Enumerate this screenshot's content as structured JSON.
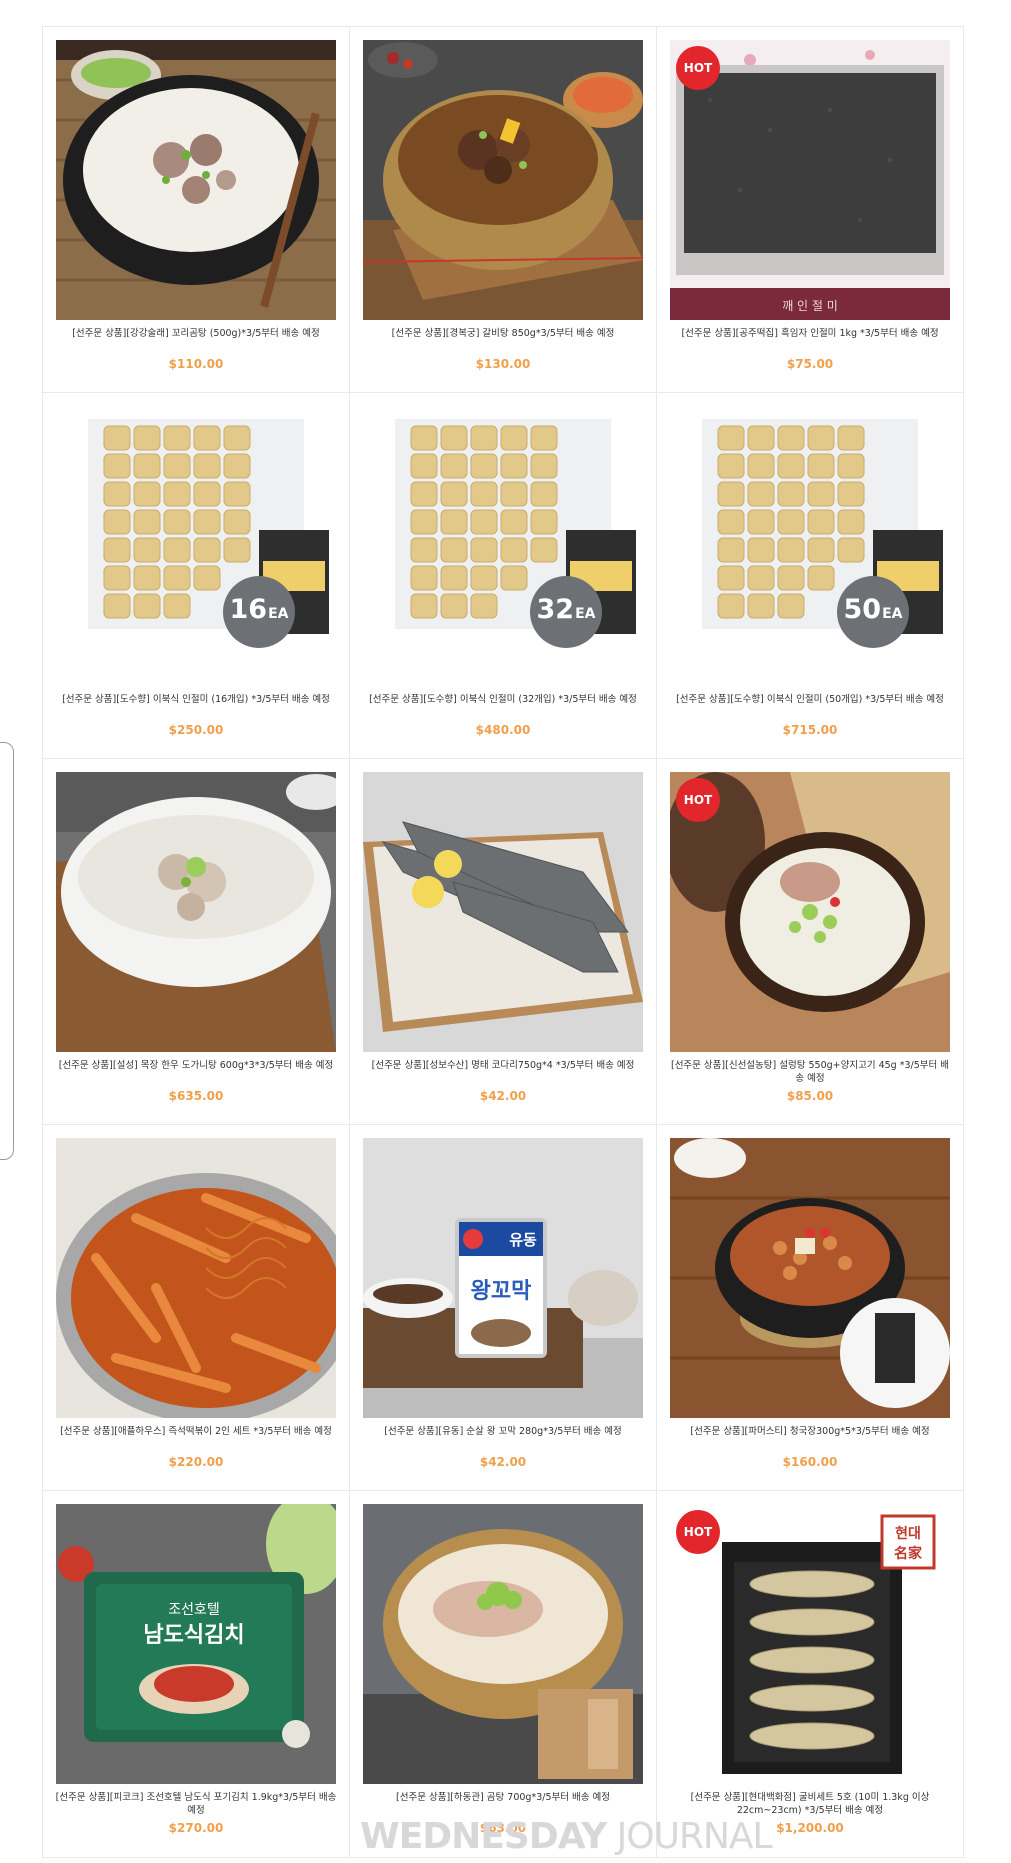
{
  "products": [
    {
      "name": "[선주문 상품][강강술래] 꼬리곰탕 (500g)*3/5부터 배송 예정",
      "price": "$110.00",
      "hot": false,
      "image": "oxtail-soup"
    },
    {
      "name": "[선주문 상품][경복궁] 갈비탕 850g*3/5부터 배송 예정",
      "price": "$130.00",
      "hot": false,
      "image": "galbi-soup"
    },
    {
      "name": "[선주문 상품][공주떡집] 흑임자 인절미 1kg *3/5부터 배송 예정",
      "price": "$75.00",
      "hot": true,
      "image": "black-sesame-injeolmi"
    },
    {
      "name": "[선주문 상품][도수향] 이북식 인절미 (16개입) *3/5부터 배송 예정",
      "price": "$250.00",
      "hot": false,
      "image": "injeolmi-box",
      "qty": "16",
      "unit": "EA"
    },
    {
      "name": "[선주문 상품][도수향] 이북식 인절미 (32개입) *3/5부터 배송 예정",
      "price": "$480.00",
      "hot": false,
      "image": "injeolmi-box",
      "qty": "32",
      "unit": "EA"
    },
    {
      "name": "[선주문 상품][도수향] 이북식 인절미 (50개입) *3/5부터 배송 예정",
      "price": "$715.00",
      "hot": false,
      "image": "injeolmi-box",
      "qty": "50",
      "unit": "EA"
    },
    {
      "name": "[선주문 상품][설성] 목장 한우 도가니탕 600g*3*3/5부터 배송 예정",
      "price": "$635.00",
      "hot": false,
      "image": "dogani-soup"
    },
    {
      "name": "[선주문 상품][성보수산] 명태 코다리750g*4 *3/5부터 배송 예정",
      "price": "$42.00",
      "hot": false,
      "image": "pollock"
    },
    {
      "name": "[선주문 상품][신선설농탕] 설렁탕 550g+양지고기 45g *3/5부터 배송 예정",
      "price": "$85.00",
      "hot": true,
      "image": "seolleongtang"
    },
    {
      "name": "[선주문 상품][애플하우스] 즉석떡볶이 2인 세트 *3/5부터 배송 예정",
      "price": "$220.00",
      "hot": false,
      "image": "tteokbokki"
    },
    {
      "name": "[선주문 상품][유동] 순살 왕 꼬막 280g*3/5부터 배송 예정",
      "price": "$42.00",
      "hot": false,
      "image": "cockle-can"
    },
    {
      "name": "[선주문 상품][파머스티] 청국장300g*5*3/5부터 배송 예정",
      "price": "$160.00",
      "hot": false,
      "image": "cheonggukjang"
    },
    {
      "name": "[선주문 상품][피코크] 조선호텔 남도식 포기김치 1.9kg*3/5부터 배송 예정",
      "price": "$270.00",
      "hot": false,
      "image": "kimchi"
    },
    {
      "name": "[선주문 상품][하동관] 곰탕 700g*3/5부터 배송 예정",
      "price": "$63.00",
      "hot": false,
      "image": "gomtang"
    },
    {
      "name": "[선주문 상품][현대백화점] 굴비세트 5호 (10미 1.3kg 이상 22cm~23cm) *3/5부터 배송 예정",
      "price": "$1,200.00",
      "hot": true,
      "image": "gulbi-set"
    }
  ],
  "hot_label": "HOT",
  "watermark": {
    "bold": "WEDNESDAY",
    "light": "JOURNAL"
  },
  "colors": {
    "price": "#f0a04b",
    "hot_badge": "#e3262b",
    "border": "#e9e9e9"
  }
}
